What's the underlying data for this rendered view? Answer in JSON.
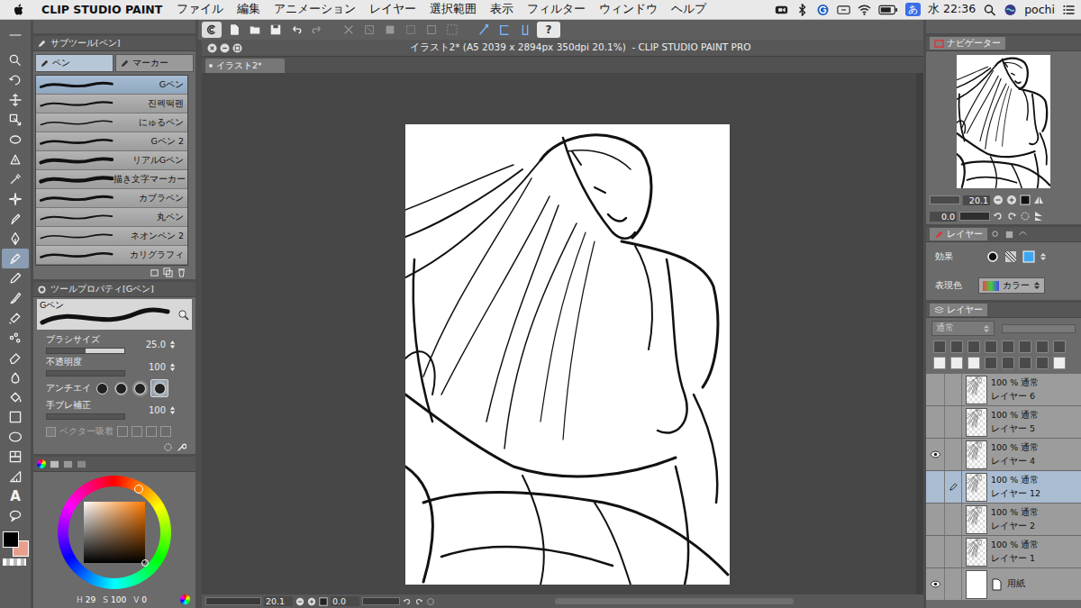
{
  "menubar": {
    "app": "CLIP STUDIO PAINT",
    "items": [
      "ファイル",
      "編集",
      "アニメーション",
      "レイヤー",
      "選択範囲",
      "表示",
      "フィルター",
      "ウィンドウ",
      "ヘルプ"
    ],
    "input_mode": "あ",
    "clock": "水 22:36",
    "user": "pochi"
  },
  "toolbar": {
    "help": "?"
  },
  "tools": [
    {
      "selected": false
    },
    {
      "selected": false
    },
    {
      "selected": false
    },
    {
      "selected": false
    },
    {
      "selected": false
    },
    {
      "selected": false
    },
    {
      "selected": false
    },
    {
      "selected": false
    },
    {
      "selected": false
    },
    {
      "selected": false
    },
    {
      "selected": true
    },
    {
      "selected": false
    },
    {
      "selected": false
    },
    {
      "selected": false
    },
    {
      "selected": false
    },
    {
      "selected": false
    },
    {
      "selected": false
    },
    {
      "selected": false
    },
    {
      "selected": false
    },
    {
      "selected": false
    },
    {
      "selected": false
    },
    {
      "selected": false
    },
    {
      "selected": false,
      "glyph": "A"
    },
    {
      "selected": false
    }
  ],
  "subtool": {
    "title": "サブツール[ペン]",
    "tabs": [
      {
        "label": "ペン",
        "selected": true
      },
      {
        "label": "マーカー",
        "selected": false
      }
    ],
    "brushes": [
      {
        "name": "Gペン",
        "selected": true
      },
      {
        "name": "진펙떡펜",
        "selected": false
      },
      {
        "name": "にゅるペン",
        "selected": false
      },
      {
        "name": "Gペン 2",
        "selected": false
      },
      {
        "name": "リアルGペン",
        "selected": false
      },
      {
        "name": "描き文字マーカー",
        "selected": false
      },
      {
        "name": "カブラペン",
        "selected": false
      },
      {
        "name": "丸ペン",
        "selected": false
      },
      {
        "name": "ネオンペン 2",
        "selected": false
      },
      {
        "name": "カリグラフィ",
        "selected": false
      }
    ]
  },
  "tool_property": {
    "title": "ツールプロパティ[Gペン]",
    "preset": "Gペン",
    "rows": [
      {
        "kind": "slider",
        "label": "ブラシサイズ",
        "value": "25.0",
        "level": 0.5
      },
      {
        "kind": "slider",
        "label": "不透明度",
        "value": "100",
        "level": 1
      },
      {
        "kind": "antialias",
        "label": "アンチエイ",
        "options": [
          {
            "selected": false
          },
          {
            "selected": false
          },
          {
            "selected": false
          },
          {
            "selected": true
          }
        ]
      },
      {
        "kind": "slider",
        "label": "手ブレ補正",
        "value": "100",
        "level": 1
      },
      {
        "kind": "checkbox",
        "label": "ベクター吸着",
        "checked": false,
        "disabled": true
      }
    ]
  },
  "color": {
    "h_label": "H",
    "h": "29",
    "s_label": "S",
    "s": "100",
    "v_label": "V",
    "v": "0",
    "main_color": "#000000",
    "sub_color": "#e8a08c"
  },
  "canvas": {
    "title": "イラスト2* (A5 2039 x 2894px 350dpi 20.1%)  - CLIP STUDIO PAINT PRO",
    "tab": "イラスト2*",
    "zoom": "20.1",
    "angle": "0.0"
  },
  "navigator": {
    "title": "ナビゲーター",
    "zoom": "20.1",
    "angle": "0.0"
  },
  "layer_property": {
    "tab": "レイヤー",
    "effect_label": "効果",
    "color_label": "表現色",
    "color_mode": "カラー"
  },
  "layers": {
    "tab": "レイヤー",
    "blend": "通常",
    "items": [
      {
        "kind": "raster",
        "name": "レイヤー 6",
        "opacity": "100 %",
        "blend": "通常",
        "visible": false,
        "editing": false,
        "selected": false
      },
      {
        "kind": "raster",
        "name": "レイヤー 5",
        "opacity": "100 %",
        "blend": "通常",
        "visible": false,
        "editing": false,
        "selected": false
      },
      {
        "kind": "raster",
        "name": "レイヤー 4",
        "opacity": "100 %",
        "blend": "通常",
        "visible": true,
        "editing": false,
        "selected": false
      },
      {
        "kind": "raster",
        "name": "レイヤー 12",
        "opacity": "100 %",
        "blend": "通常",
        "visible": false,
        "editing": true,
        "selected": true
      },
      {
        "kind": "raster",
        "name": "レイヤー 2",
        "opacity": "100 %",
        "blend": "通常",
        "visible": false,
        "editing": false,
        "selected": false
      },
      {
        "kind": "raster",
        "name": "レイヤー 1",
        "opacity": "100 %",
        "blend": "通常",
        "visible": false,
        "editing": false,
        "selected": false
      },
      {
        "kind": "paper",
        "name": "用紙",
        "visible": true,
        "editing": false,
        "selected": false
      }
    ]
  }
}
